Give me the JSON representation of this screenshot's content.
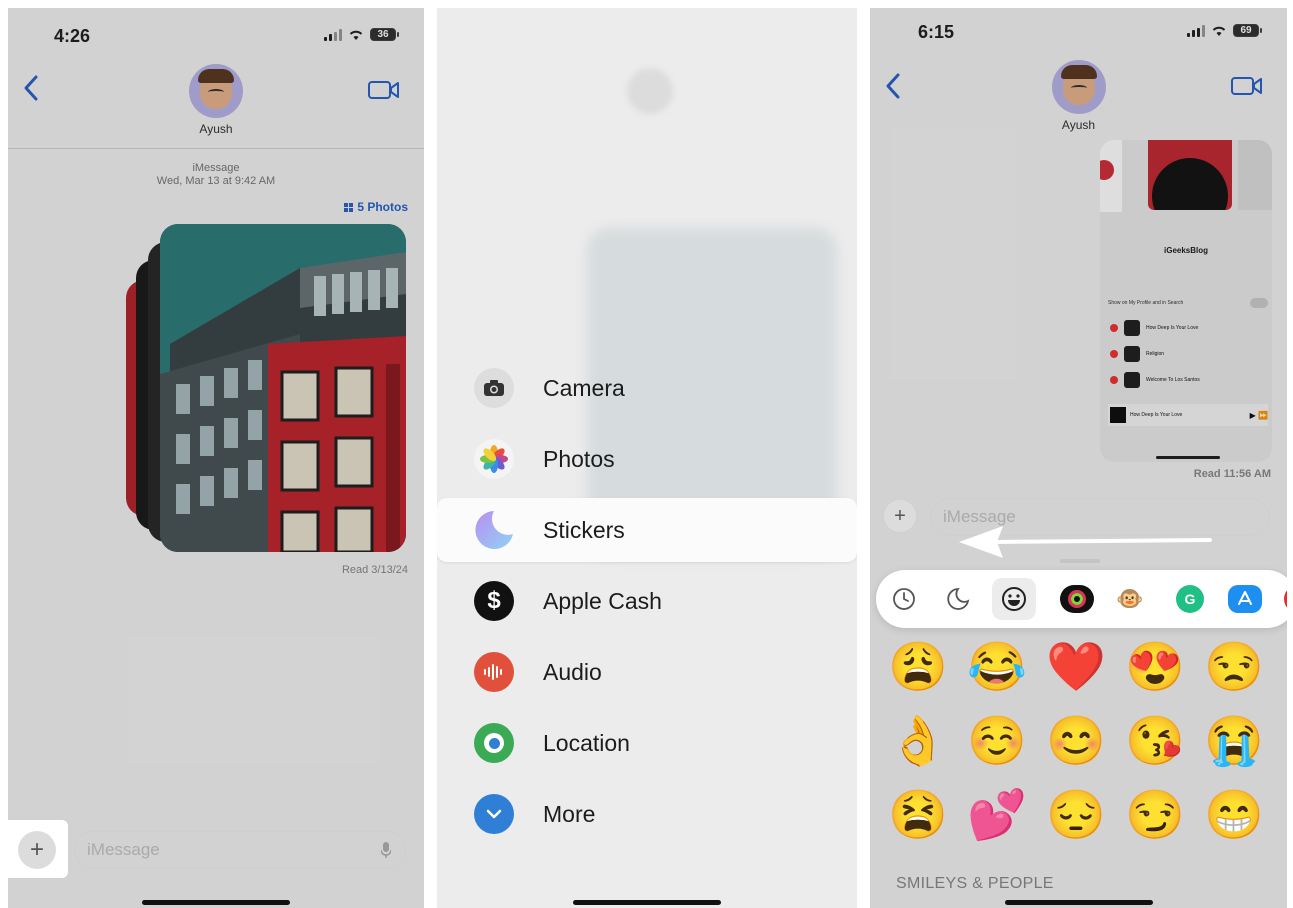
{
  "panel1": {
    "time": "4:26",
    "battery": "36",
    "contact": "Ayush",
    "service": "iMessage",
    "timestamp": "Wed, Mar 13 at 9:42 AM",
    "photos_link": "5 Photos",
    "read_status": "Read 3/13/24",
    "message_placeholder": "iMessage"
  },
  "panel2": {
    "menu": [
      {
        "label": "Camera",
        "icon": "camera-icon",
        "color": "#dddddd"
      },
      {
        "label": "Photos",
        "icon": "photos-icon",
        "color": "#f4f4f4"
      },
      {
        "label": "Stickers",
        "icon": "stickers-icon",
        "color": "#c9c2f2"
      },
      {
        "label": "Apple Cash",
        "icon": "apple-cash-icon",
        "color": "#111111"
      },
      {
        "label": "Audio",
        "icon": "audio-icon",
        "color": "#e0503a"
      },
      {
        "label": "Location",
        "icon": "location-icon",
        "color": "#3aaa55"
      },
      {
        "label": "More",
        "icon": "more-icon",
        "color": "#2f7fd6"
      }
    ],
    "selected": "Stickers"
  },
  "panel3": {
    "time": "6:15",
    "battery": "69",
    "contact": "Ayush",
    "embed": {
      "title": "iGeeksBlog",
      "toggle_label": "Show on My Profile and in Search",
      "songs": [
        "How Deep Is Your Love",
        "Religion",
        "Welcome To Los Santos"
      ],
      "now_playing": "How Deep Is Your Love"
    },
    "read_status": "Read 11:56 AM",
    "message_placeholder": "iMessage",
    "apps": [
      "recents-icon",
      "stickers-icon",
      "emoji-icon",
      "fitness-icon",
      "memoji-icon",
      "grammarly-icon",
      "app-store-icon",
      "more-app-icon"
    ],
    "emojis": [
      "😩",
      "😂",
      "❤️",
      "😍",
      "😒",
      "👌",
      "☺️",
      "😊",
      "😘",
      "😭",
      "😫",
      "💕",
      "😔",
      "😏",
      "😁"
    ],
    "section_title": "SMILEYS & PEOPLE"
  },
  "colors": {
    "accent": "#2a62c9",
    "building_red": "#c0262f",
    "photo_teal": "#2f7c7c"
  }
}
